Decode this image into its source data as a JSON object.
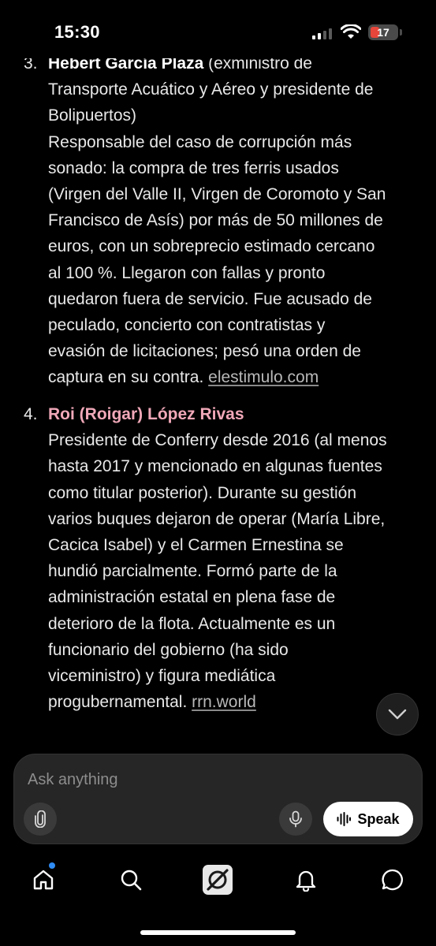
{
  "status_bar": {
    "time": "15:30",
    "battery": "17"
  },
  "items": [
    {
      "number": "3.",
      "name": "Hebert García Plaza",
      "name_suffix": "(exministro de",
      "lines": [
        "Transporte Acuático y Aéreo y presidente de",
        "Bolipuertos)",
        "Responsable del caso de corrupción más",
        "sonado: la compra de tres ferris usados",
        "(Virgen del Valle II, Virgen de Coromoto y San",
        "Francisco de Asís) por más de 50 millones de",
        "euros, con un sobreprecio estimado cercano",
        "al 100 %. Llegaron con fallas y pronto",
        "quedaron fuera de servicio. Fue acusado de",
        "peculado, concierto con contratistas y",
        "evasión de licitaciones; pesó una orden de"
      ],
      "last_line": "captura en su contra.",
      "source": "elestimulo.com"
    },
    {
      "number": "4.",
      "name": "Roi (Roigar) López Rivas",
      "lines": [
        "Presidente de Conferry desde 2016 (al menos",
        "hasta 2017 y mencionado en algunas fuentes",
        "como titular posterior). Durante su gestión",
        "varios buques dejaron de operar (María Libre,",
        "Cacica Isabel) y el Carmen Ernestina se",
        "hundió parcialmente. Formó parte de la",
        "administración estatal en plena fase de",
        "deterioro de la flota. Actualmente es un",
        "funcionario del gobierno (ha sido",
        "viceministro) y figura mediática"
      ],
      "last_line": "progubernamental.",
      "source": "rrn.world"
    }
  ],
  "composer": {
    "placeholder": "Ask anything",
    "speak_label": "Speak"
  },
  "icons": {
    "scroll": "chevron-down-icon",
    "attach": "paperclip-icon",
    "mic": "microphone-icon",
    "speak": "waveform-icon",
    "nav": [
      "home-icon",
      "search-icon",
      "grok-logo-icon",
      "bell-icon",
      "chat-bubble-icon"
    ]
  },
  "colors": {
    "background": "#000000",
    "text": "#e8e8e8",
    "highlight_name": "#f0a8b8",
    "link": "#b8b8b8",
    "notification_dot": "#2f8cf5",
    "battery_low": "#e5453a"
  }
}
